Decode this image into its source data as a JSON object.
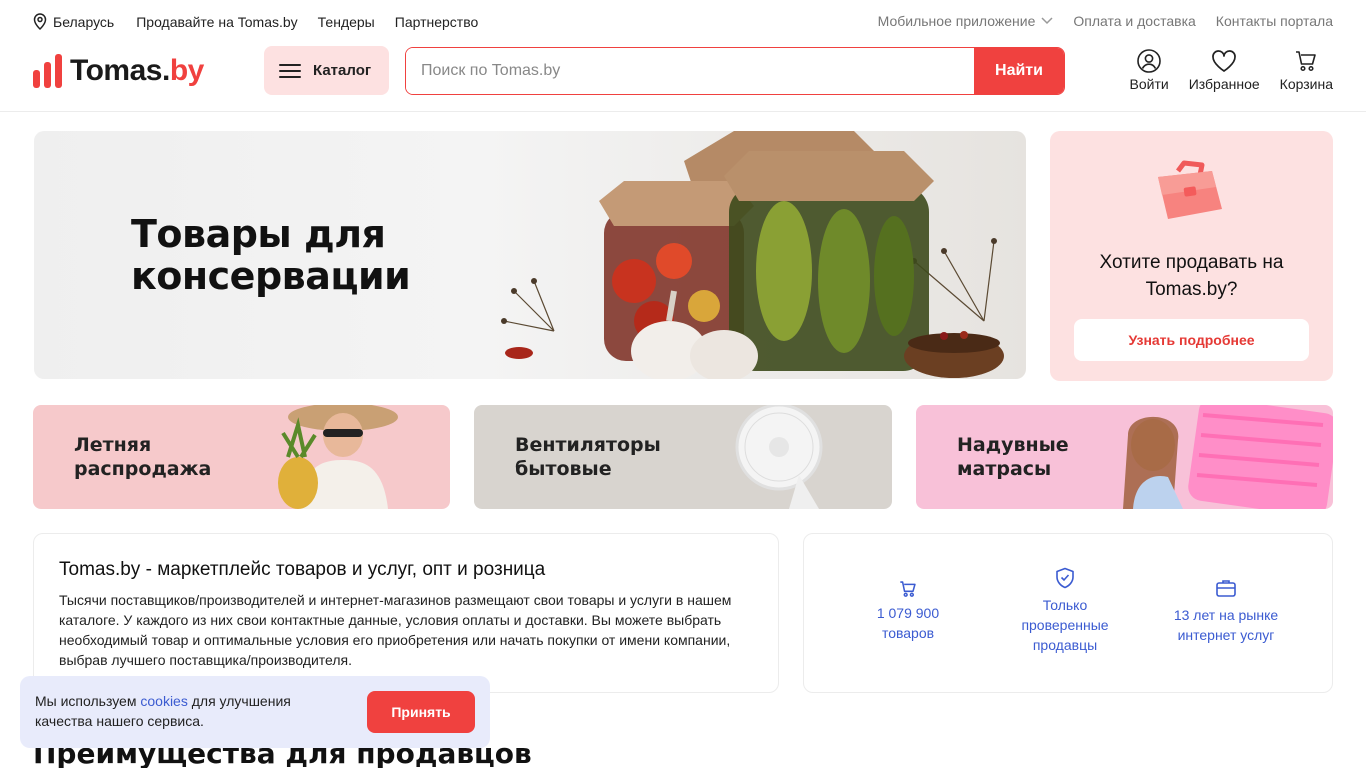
{
  "topbar": {
    "location": "Беларусь",
    "links": [
      "Продавайте на Tomas.by",
      "Тендеры",
      "Партнерство"
    ],
    "right_links": [
      "Мобильное приложение",
      "Оплата и доставка",
      "Контакты портала"
    ]
  },
  "header": {
    "logo_main": "Tomas.",
    "logo_accent": "by",
    "catalog_label": "Каталог",
    "search_placeholder": "Поиск по Tomas.by",
    "search_button": "Найти",
    "icons": [
      {
        "label": "Войти",
        "icon": "user-icon"
      },
      {
        "label": "Избранное",
        "icon": "heart-icon"
      },
      {
        "label": "Корзина",
        "icon": "cart-icon"
      }
    ]
  },
  "hero": {
    "title_line1": "Товары для",
    "title_line2": "консервации"
  },
  "sell_card": {
    "question_line1": "Хотите продавать на",
    "question_line2": "Tomas.by?",
    "button": "Узнать подробнее"
  },
  "promos": [
    {
      "line1": "Летняя",
      "line2": "распродажа"
    },
    {
      "line1": "Вентиляторы",
      "line2": "бытовые"
    },
    {
      "line1": "Надувные",
      "line2": "матрасы"
    }
  ],
  "about": {
    "title": "Tomas.by - маркетплейс товаров и услуг, опт и розница",
    "text": "Тысячи поставщиков/производителей и интернет-магазинов размещают свои товары и услуги в нашем каталоге. У каждого из них свои контактные данные, условия оплаты и доставки. Вы можете выбрать необходимый товар и оптимальные условия его приобретения или начать покупки от имени компании, выбрав лучшего поставщика/производителя."
  },
  "stats": [
    {
      "line1": "1 079 900",
      "line2": "товаров",
      "icon": "cart-icon"
    },
    {
      "line1": "Только",
      "line2": "проверенные",
      "line3": "продавцы",
      "icon": "shield-check-icon"
    },
    {
      "line1": "13 лет на рынке",
      "line2": "интернет услуг",
      "icon": "briefcase-icon"
    }
  ],
  "cookie": {
    "text_before": "Мы используем ",
    "link": "cookies",
    "text_after": " для улучшения качества нашего сервиса.",
    "button": "Принять"
  },
  "section_title": "Преимущества для продавцов",
  "colors": {
    "accent": "#f0413f",
    "link": "#3b5bd1",
    "pink_bg": "#fde1e1"
  }
}
